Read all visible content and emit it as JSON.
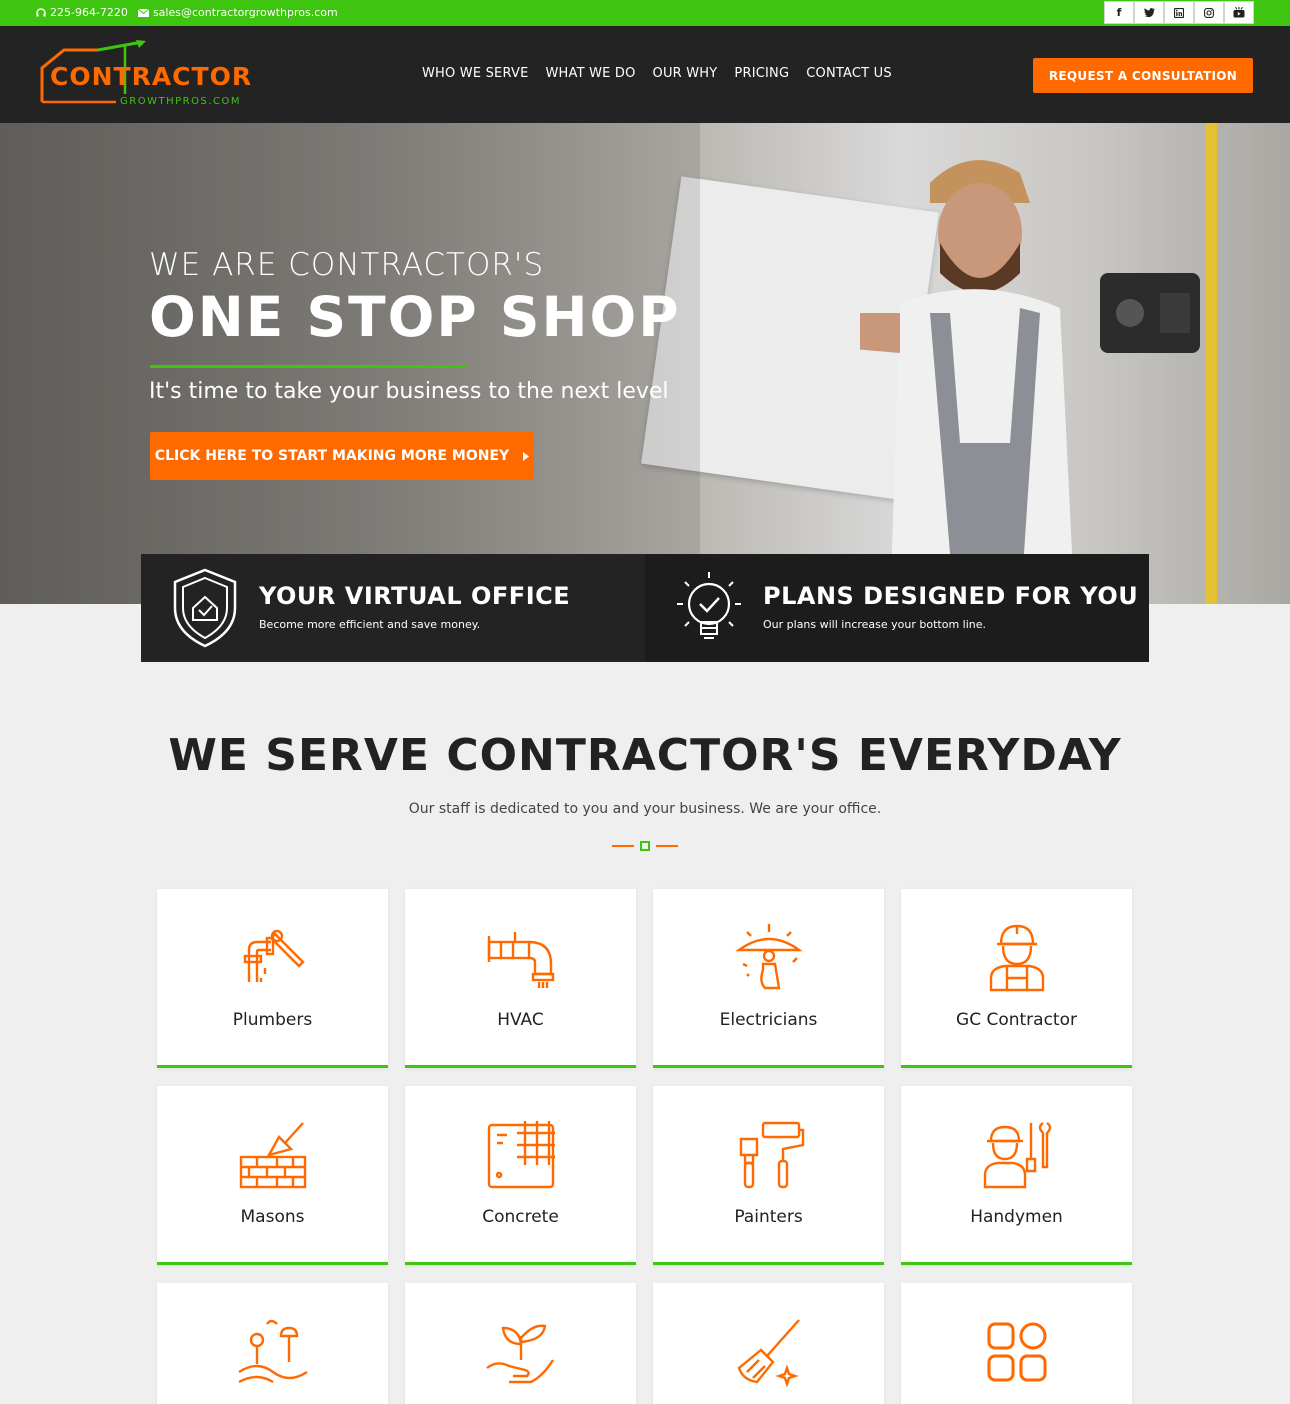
{
  "topbar": {
    "phone": "225-964-7220",
    "email": "sales@contractorgrowthpros.com",
    "socials": [
      "f",
      "t",
      "in",
      "ig",
      "yt"
    ]
  },
  "header": {
    "logo_word": "CONTRACTOR",
    "logo_sub": "GROWTHPROS.COM",
    "nav": [
      "WHO WE SERVE",
      "WHAT WE DO",
      "OUR WHY",
      "PRICING",
      "CONTACT US"
    ],
    "cta": "REQUEST A CONSULTATION"
  },
  "hero": {
    "eyebrow": "WE ARE CONTRACTOR'S",
    "headline": "ONE STOP SHOP",
    "tagline": "It's time to take your business to the next level",
    "cta": "CLICK HERE TO START MAKING MORE MONEY"
  },
  "features": [
    {
      "title": "YOUR VIRTUAL OFFICE",
      "text": "Become more efficient and save money.",
      "icon": "shield-house-icon"
    },
    {
      "title": "PLANS DESIGNED FOR YOU",
      "text": "Our plans will increase your bottom line.",
      "icon": "lightbulb-check-icon"
    }
  ],
  "serve": {
    "title": "WE SERVE CONTRACTOR'S EVERYDAY",
    "subtitle": "Our staff is dedicated to you and your business. We are your office.",
    "cards": [
      {
        "label": "Plumbers",
        "icon": "pipe-wrench-icon"
      },
      {
        "label": "HVAC",
        "icon": "duct-icon"
      },
      {
        "label": "Electricians",
        "icon": "light-fixture-icon"
      },
      {
        "label": "GC Contractor",
        "icon": "worker-helmet-icon"
      },
      {
        "label": "Masons",
        "icon": "bricks-trowel-icon"
      },
      {
        "label": "Concrete",
        "icon": "rebar-icon"
      },
      {
        "label": "Painters",
        "icon": "paint-roller-icon"
      },
      {
        "label": "Handymen",
        "icon": "handyman-icon"
      },
      {
        "label": "",
        "icon": "landscape-icon"
      },
      {
        "label": "",
        "icon": "plant-hand-icon"
      },
      {
        "label": "",
        "icon": "broom-icon"
      },
      {
        "label": "",
        "icon": "grid-icon"
      }
    ]
  },
  "colors": {
    "green": "#3ec50f",
    "orange": "#ff6a00",
    "dark": "#232323"
  }
}
